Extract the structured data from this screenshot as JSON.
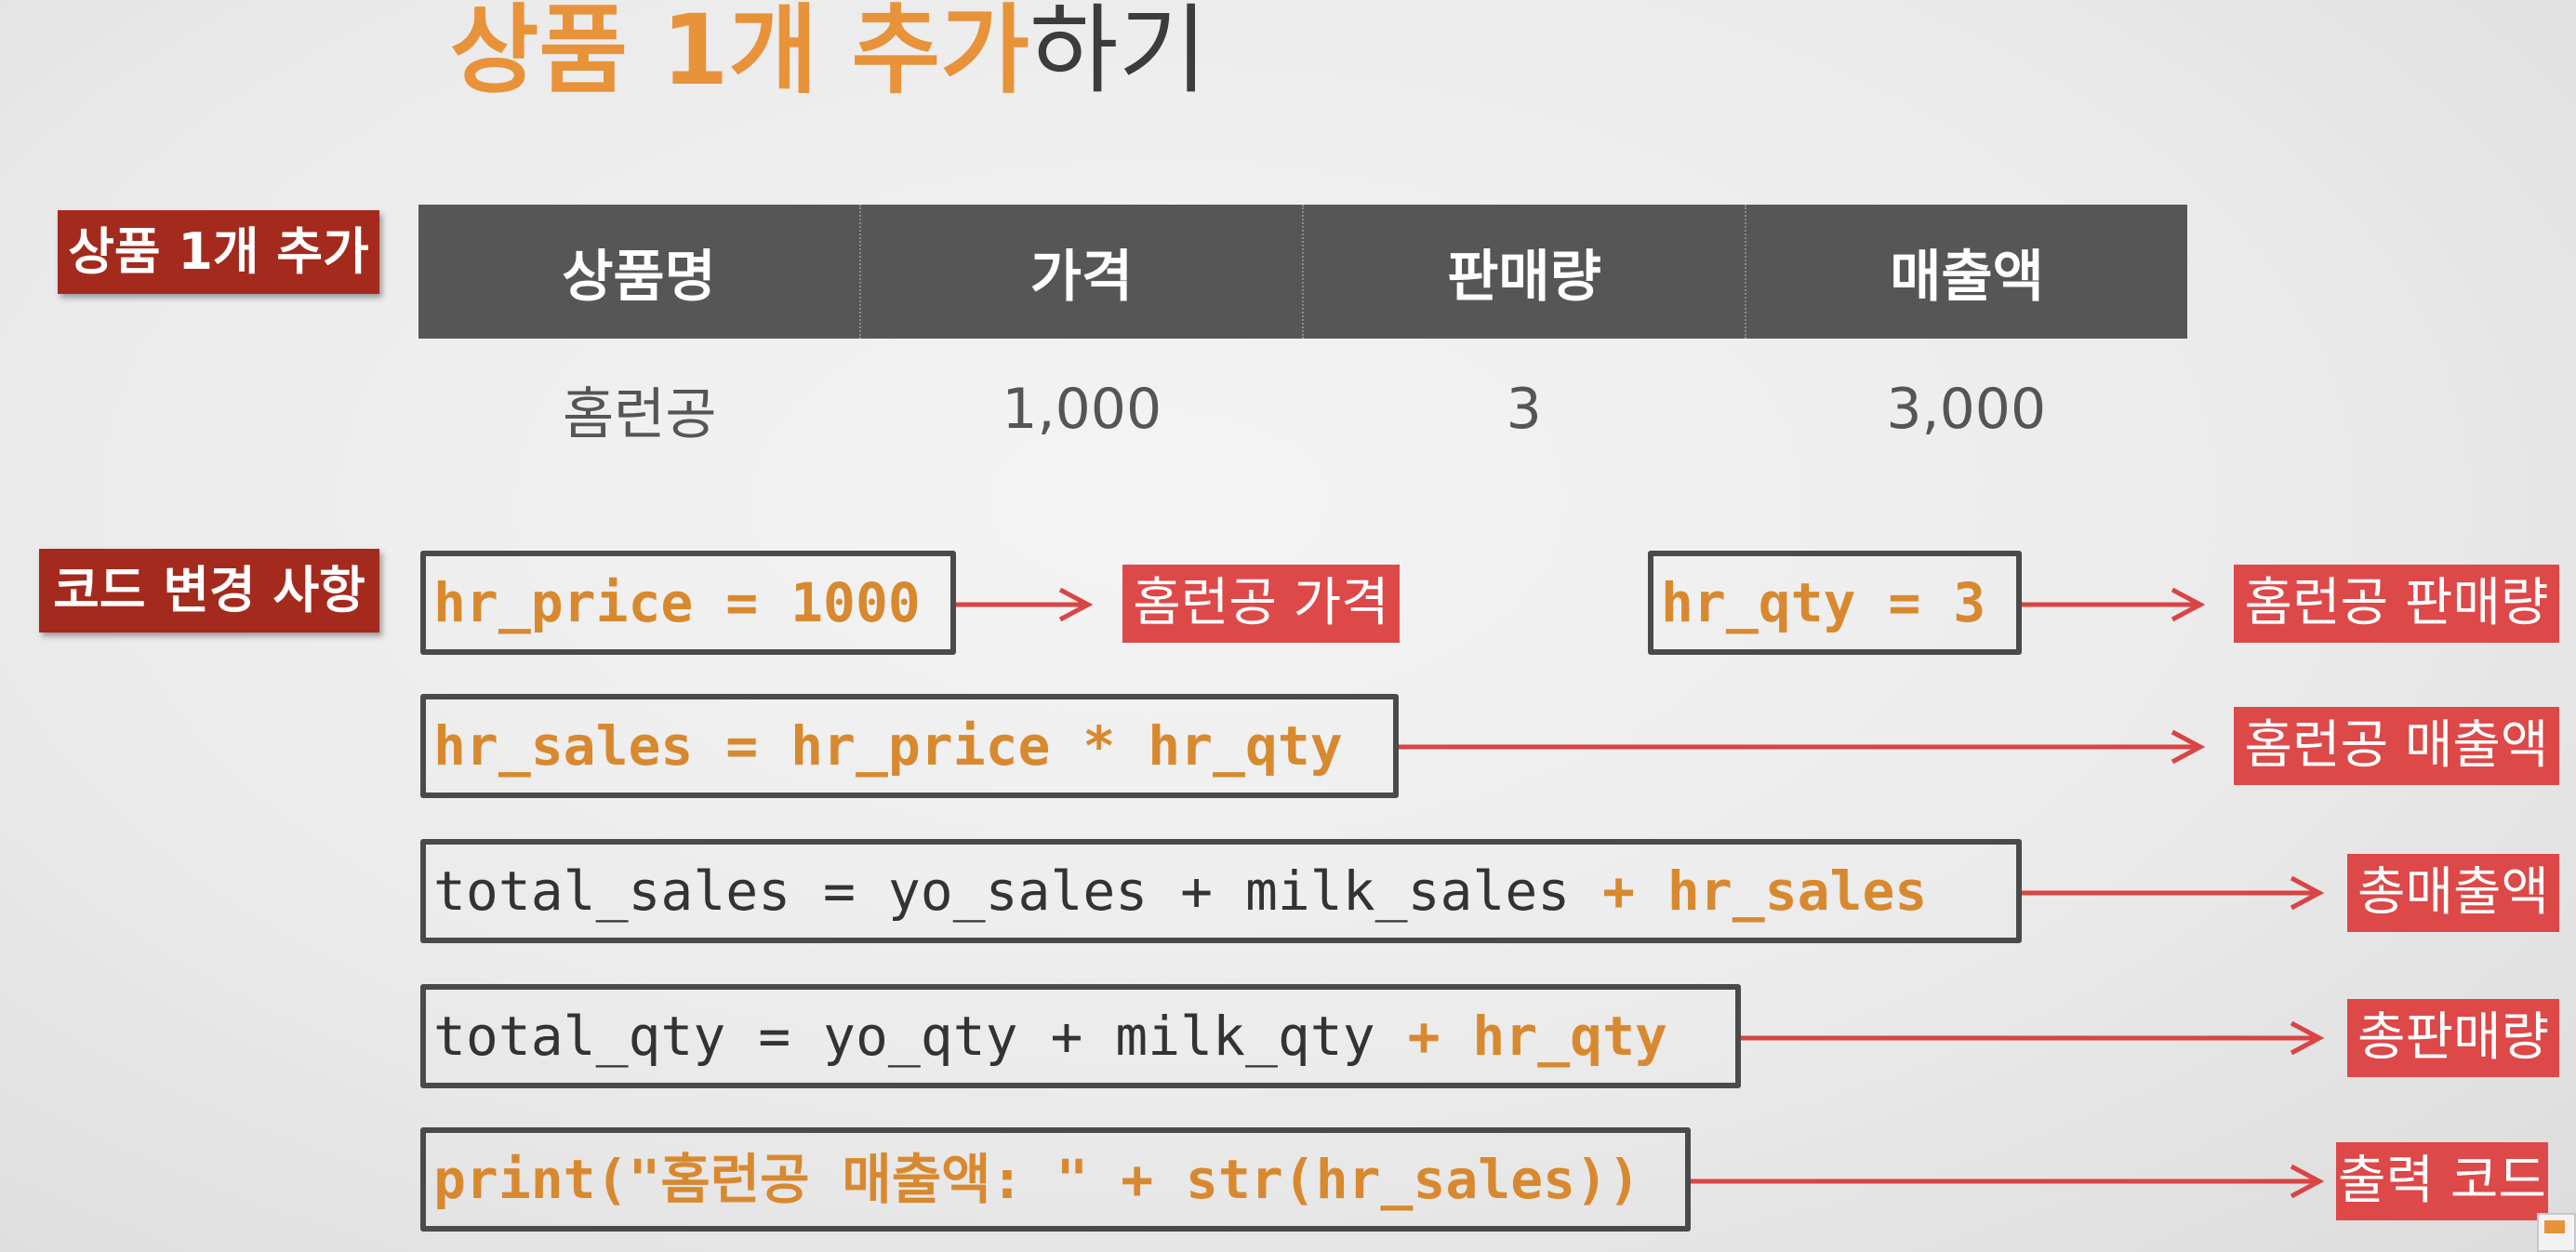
{
  "title": {
    "accent": "상품 1개 추가",
    "rest": "하기"
  },
  "section_labels": {
    "add_product": "상품 1개 추가",
    "code_changes": "코드 변경 사항"
  },
  "table": {
    "headers": [
      "상품명",
      "가격",
      "판매량",
      "매출액"
    ],
    "row": [
      "홈런공",
      "1,000",
      "3",
      "3,000"
    ]
  },
  "code_lines": {
    "hr_price": {
      "text": "hr_price = 1000",
      "note": "홈런공 가격"
    },
    "hr_qty": {
      "text": "hr_qty = 3",
      "note": "홈런공 판매량"
    },
    "hr_sales": {
      "text": "hr_sales = hr_price * hr_qty",
      "note": "홈런공 매출액"
    },
    "total_sales": {
      "plain": "total_sales = yo_sales + milk_sales ",
      "highlight": "+ hr_sales",
      "note": "총매출액"
    },
    "total_qty": {
      "plain": "total_qty = yo_qty + milk_qty ",
      "highlight": "+ hr_qty",
      "note": "총판매량"
    },
    "print": {
      "text": "print(\"홈런공 매출액: \" + str(hr_sales))",
      "note": "출력 코드"
    }
  },
  "colors": {
    "accent": "#e8923a",
    "label_bg": "#a42a1e",
    "note_bg": "#dd4848",
    "header_bg": "#555655",
    "arrow": "#d94444"
  }
}
